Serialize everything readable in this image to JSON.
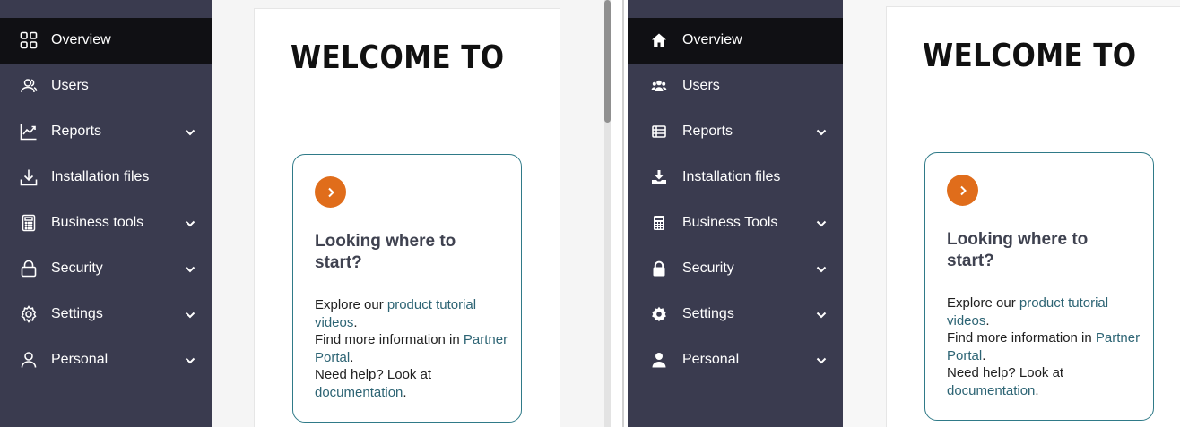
{
  "left": {
    "sidebar": {
      "items": [
        {
          "label": "Overview",
          "icon": "grid-icon",
          "active": true,
          "chevron": false
        },
        {
          "label": "Users",
          "icon": "users-outline-icon",
          "chevron": false
        },
        {
          "label": "Reports",
          "icon": "chart-icon",
          "chevron": true
        },
        {
          "label": "Installation files",
          "icon": "download-icon",
          "chevron": false
        },
        {
          "label": "Business tools",
          "icon": "calculator-icon",
          "chevron": true
        },
        {
          "label": "Security",
          "icon": "lock-icon",
          "chevron": true
        },
        {
          "label": "Settings",
          "icon": "gear-icon",
          "chevron": true
        },
        {
          "label": "Personal",
          "icon": "person-icon",
          "chevron": true
        }
      ]
    },
    "main": {
      "welcome": "WELCOME TO",
      "info": {
        "title": "Looking where to start?",
        "line1_prefix": "Explore our ",
        "line1_link": "product tutorial videos",
        "line1_suffix": ".",
        "line2_prefix": "Find more information in ",
        "line2_link": "Partner Portal",
        "line2_suffix": ".",
        "line3_prefix": "Need help? Look at ",
        "line3_link": "documentation",
        "line3_suffix": "."
      }
    }
  },
  "right": {
    "sidebar": {
      "items": [
        {
          "label": "Overview",
          "icon": "home-icon",
          "active": true,
          "chevron": false
        },
        {
          "label": "Users",
          "icon": "users-filled-icon",
          "chevron": false
        },
        {
          "label": "Reports",
          "icon": "table-icon",
          "chevron": true
        },
        {
          "label": "Installation files",
          "icon": "download-tray-icon",
          "chevron": false
        },
        {
          "label": "Business Tools",
          "icon": "calculator-filled-icon",
          "chevron": true
        },
        {
          "label": "Security",
          "icon": "lock-filled-icon",
          "chevron": true
        },
        {
          "label": "Settings",
          "icon": "gear-filled-icon",
          "chevron": true
        },
        {
          "label": "Personal",
          "icon": "person-filled-icon",
          "chevron": true
        }
      ]
    },
    "main": {
      "welcome": "WELCOME TO",
      "info": {
        "title": "Looking where to start?",
        "line1_prefix": "Explore our ",
        "line1_link": "product tutorial videos",
        "line1_suffix": ".",
        "line2_prefix": "Find more information in ",
        "line2_link": "Partner Portal",
        "line2_suffix": ".",
        "line3_prefix": "Need help? Look at ",
        "line3_link": "documentation",
        "line3_suffix": "."
      }
    }
  },
  "colors": {
    "sidebar_bg": "#3a3b4f",
    "active_bg": "#101014",
    "accent_orange": "#e06d1b",
    "link": "#2d6474",
    "box_border": "#2f7a88"
  }
}
